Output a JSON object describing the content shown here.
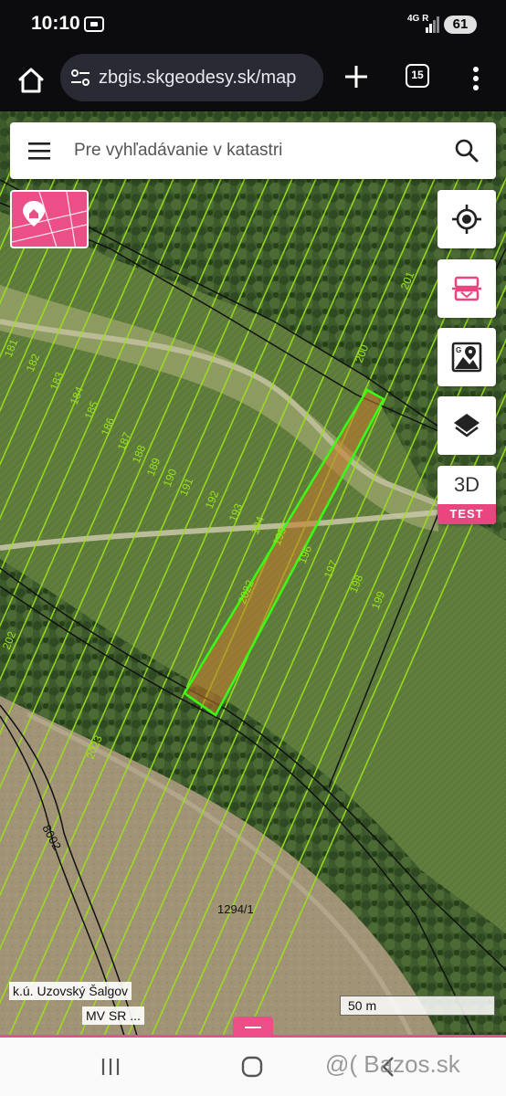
{
  "status_bar": {
    "time": "10:10",
    "network": "4G",
    "network_extra": "R",
    "battery": "61"
  },
  "browser": {
    "url": "zbgis.skgeodesy.sk/map",
    "tab_count": "15"
  },
  "search": {
    "placeholder": "Pre vyhľadávanie v katastri"
  },
  "tools": {
    "three_d_label": "3D",
    "three_d_badge": "TEST"
  },
  "map": {
    "parcel_numbers": [
      "181",
      "182",
      "183",
      "184",
      "185",
      "186",
      "187",
      "188",
      "189",
      "190",
      "191",
      "192",
      "193",
      "194",
      "195",
      "196",
      "197",
      "198",
      "199",
      "200",
      "201",
      "202",
      "2022",
      "2023"
    ],
    "parcel_main": "1294/1",
    "road_label": "8002",
    "selected_parcel": "2022",
    "cadastral_area": "k.ú. Uzovský Šalgov",
    "authority": "MV SR ...",
    "scale": "50 m"
  },
  "colors": {
    "accent": "#ec4f87",
    "parcel_line": "#9be21c",
    "selection_stroke": "#39ff14",
    "selection_fill": "#c8782e"
  },
  "watermark": "@( Bazos.sk"
}
